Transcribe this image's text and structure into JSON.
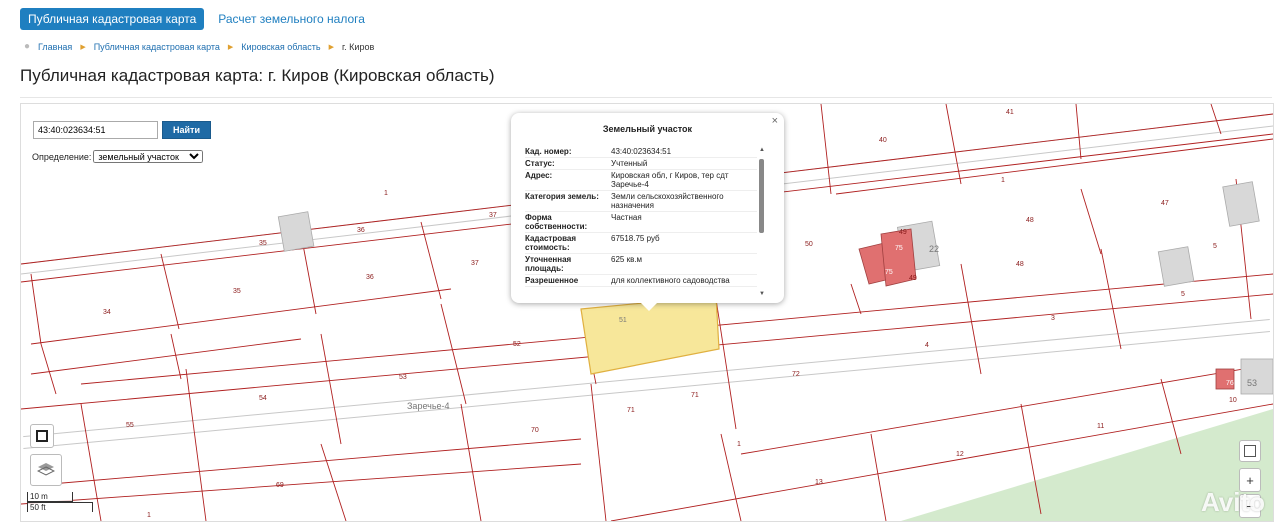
{
  "tabs": [
    "Публичная кадастровая карта",
    "Расчет земельного налога"
  ],
  "breadcrumbs": [
    "Главная",
    "Публичная кадастровая карта",
    "Кировская область",
    "г. Киров"
  ],
  "page_title": "Публичная кадастровая карта: г. Киров (Кировская область)",
  "search": {
    "value": "43:40:023634:51",
    "button": "Найти"
  },
  "definition": {
    "label": "Определение:",
    "selected": "земельный участок"
  },
  "popup": {
    "title": "Земельный участок",
    "close": "×",
    "rows": [
      {
        "k": "Кад. номер:",
        "v": "43:40:023634:51"
      },
      {
        "k": "Статус:",
        "v": "Учтенный"
      },
      {
        "k": "Адрес:",
        "v": "Кировская обл, г Киров, тер сдт Заречье-4"
      },
      {
        "k": "Категория земель:",
        "v": "Земли сельскохозяйственного назначения"
      },
      {
        "k": "Форма собственности:",
        "v": "Частная"
      },
      {
        "k": "Кадастровая стоимость:",
        "v": "67518.75 руб"
      },
      {
        "k": "Уточненная площадь:",
        "v": "625 кв.м"
      },
      {
        "k": "Разрешенное",
        "v": "для коллективного садоводства"
      }
    ]
  },
  "map": {
    "area_label": "Заречье-4",
    "selected_label": "51",
    "parcel_labels": [
      "40",
      "41",
      "1",
      "47",
      "48",
      "49",
      "75",
      "22",
      "50",
      "5",
      "5",
      "3",
      "4",
      "37",
      "37",
      "36",
      "36",
      "35",
      "35",
      "1",
      "34",
      "52",
      "53",
      "54",
      "55",
      "69",
      "70",
      "71",
      "71",
      "72",
      "1",
      "11",
      "12",
      "13",
      "76",
      "53",
      "10",
      "1"
    ],
    "selected_color": "#f7e79a",
    "building_color": "#e07070"
  },
  "scale": [
    "10 m",
    "50 ft"
  ],
  "zoom": [
    "+",
    "−"
  ],
  "watermark": "Avito"
}
